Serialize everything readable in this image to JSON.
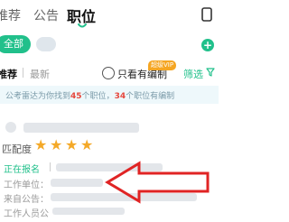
{
  "tabs": [
    {
      "label": "推荐"
    },
    {
      "label": "公告"
    },
    {
      "label": "职位"
    }
  ],
  "filter": {
    "chip_all": "全部",
    "add": "+"
  },
  "sort": {
    "recommend": "推荐",
    "latest": "最新",
    "only_bianzhi": "只看有编制",
    "vip_badge": "超级VIP",
    "filter": "筛选"
  },
  "banner": {
    "prefix": "公考雷达为你找到",
    "total": "45",
    "mid": "个职位，",
    "bianzhi": "34",
    "suffix": "个职位有编制"
  },
  "card": {
    "match_label": "匹配度",
    "stars": 4,
    "status": "正在报名",
    "unit_label": "工作单位：",
    "source_label": "来自公告：",
    "people_label": "工作人员公"
  },
  "colors": {
    "accent": "#21c08b",
    "highlight": "#e5473d",
    "star": "#f4a928",
    "vip": "#f5a623",
    "arrow": "#e02424"
  }
}
